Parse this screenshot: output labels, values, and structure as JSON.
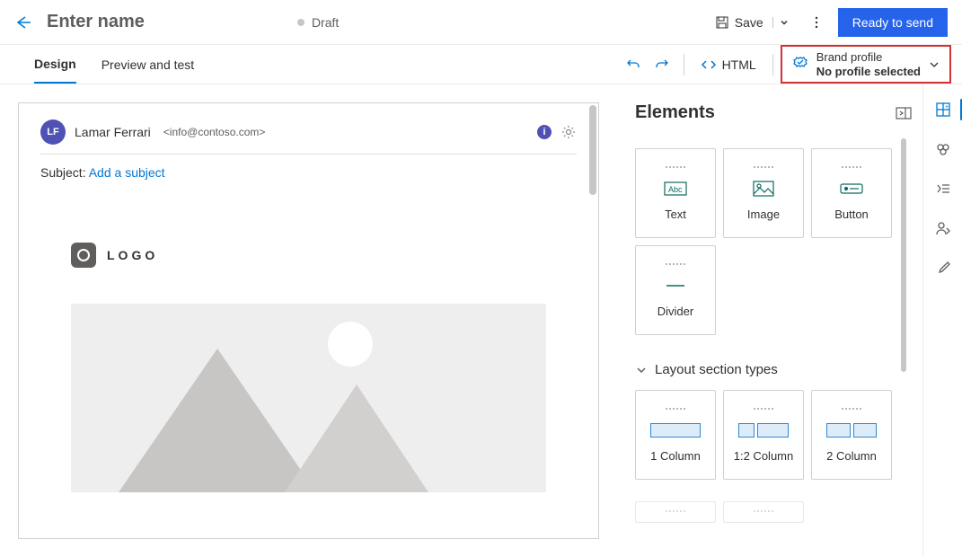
{
  "header": {
    "title": "Enter name",
    "status": "Draft",
    "save_label": "Save",
    "primary_label": "Ready to send"
  },
  "tabs": {
    "design": "Design",
    "preview": "Preview and test",
    "html_label": "HTML",
    "brand_top": "Brand profile",
    "brand_bottom": "No profile selected"
  },
  "email": {
    "avatar_initials": "LF",
    "sender_name": "Lamar Ferrari",
    "sender_email": "<info@contoso.com>",
    "subject_label": "Subject:",
    "subject_link": "Add a subject",
    "logo_text": "LOGO"
  },
  "panel": {
    "title": "Elements",
    "tiles": {
      "text": "Text",
      "image": "Image",
      "button": "Button",
      "divider": "Divider"
    },
    "layout_header": "Layout section types",
    "layouts": {
      "one": "1 Column",
      "one_two": "1:2 Column",
      "two": "2 Column"
    }
  }
}
